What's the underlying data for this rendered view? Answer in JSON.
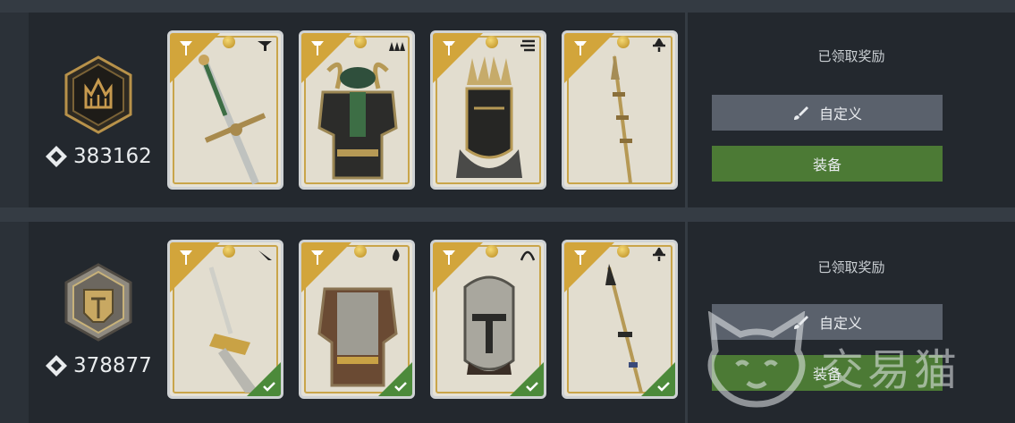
{
  "rows": [
    {
      "score": "383162",
      "status": "已领取奖励",
      "customize_label": "自定义",
      "equip_label": "装备",
      "cards": [
        {
          "item": "sword",
          "type_icon": "class-icon",
          "equipped": false
        },
        {
          "item": "armor",
          "type_icon": "spikes-icon",
          "equipped": false
        },
        {
          "item": "helmet",
          "type_icon": "speed-lines-icon",
          "equipped": false
        },
        {
          "item": "spear",
          "type_icon": "spear-class-icon",
          "equipped": false
        }
      ]
    },
    {
      "score": "378877",
      "status": "已领取奖励",
      "customize_label": "自定义",
      "equip_label": "装备",
      "cards": [
        {
          "item": "sword",
          "type_icon": "blade-icon",
          "equipped": true
        },
        {
          "item": "armor",
          "type_icon": "flame-icon",
          "equipped": true
        },
        {
          "item": "helmet",
          "type_icon": "arc-icon",
          "equipped": true
        },
        {
          "item": "spear",
          "type_icon": "spear-class-icon",
          "equipped": true
        }
      ]
    }
  ],
  "watermark": "交易猫",
  "colors": {
    "accent_gold": "#d2a53b",
    "equip_green": "#4c7a35",
    "custom_grey": "#5a616c"
  }
}
